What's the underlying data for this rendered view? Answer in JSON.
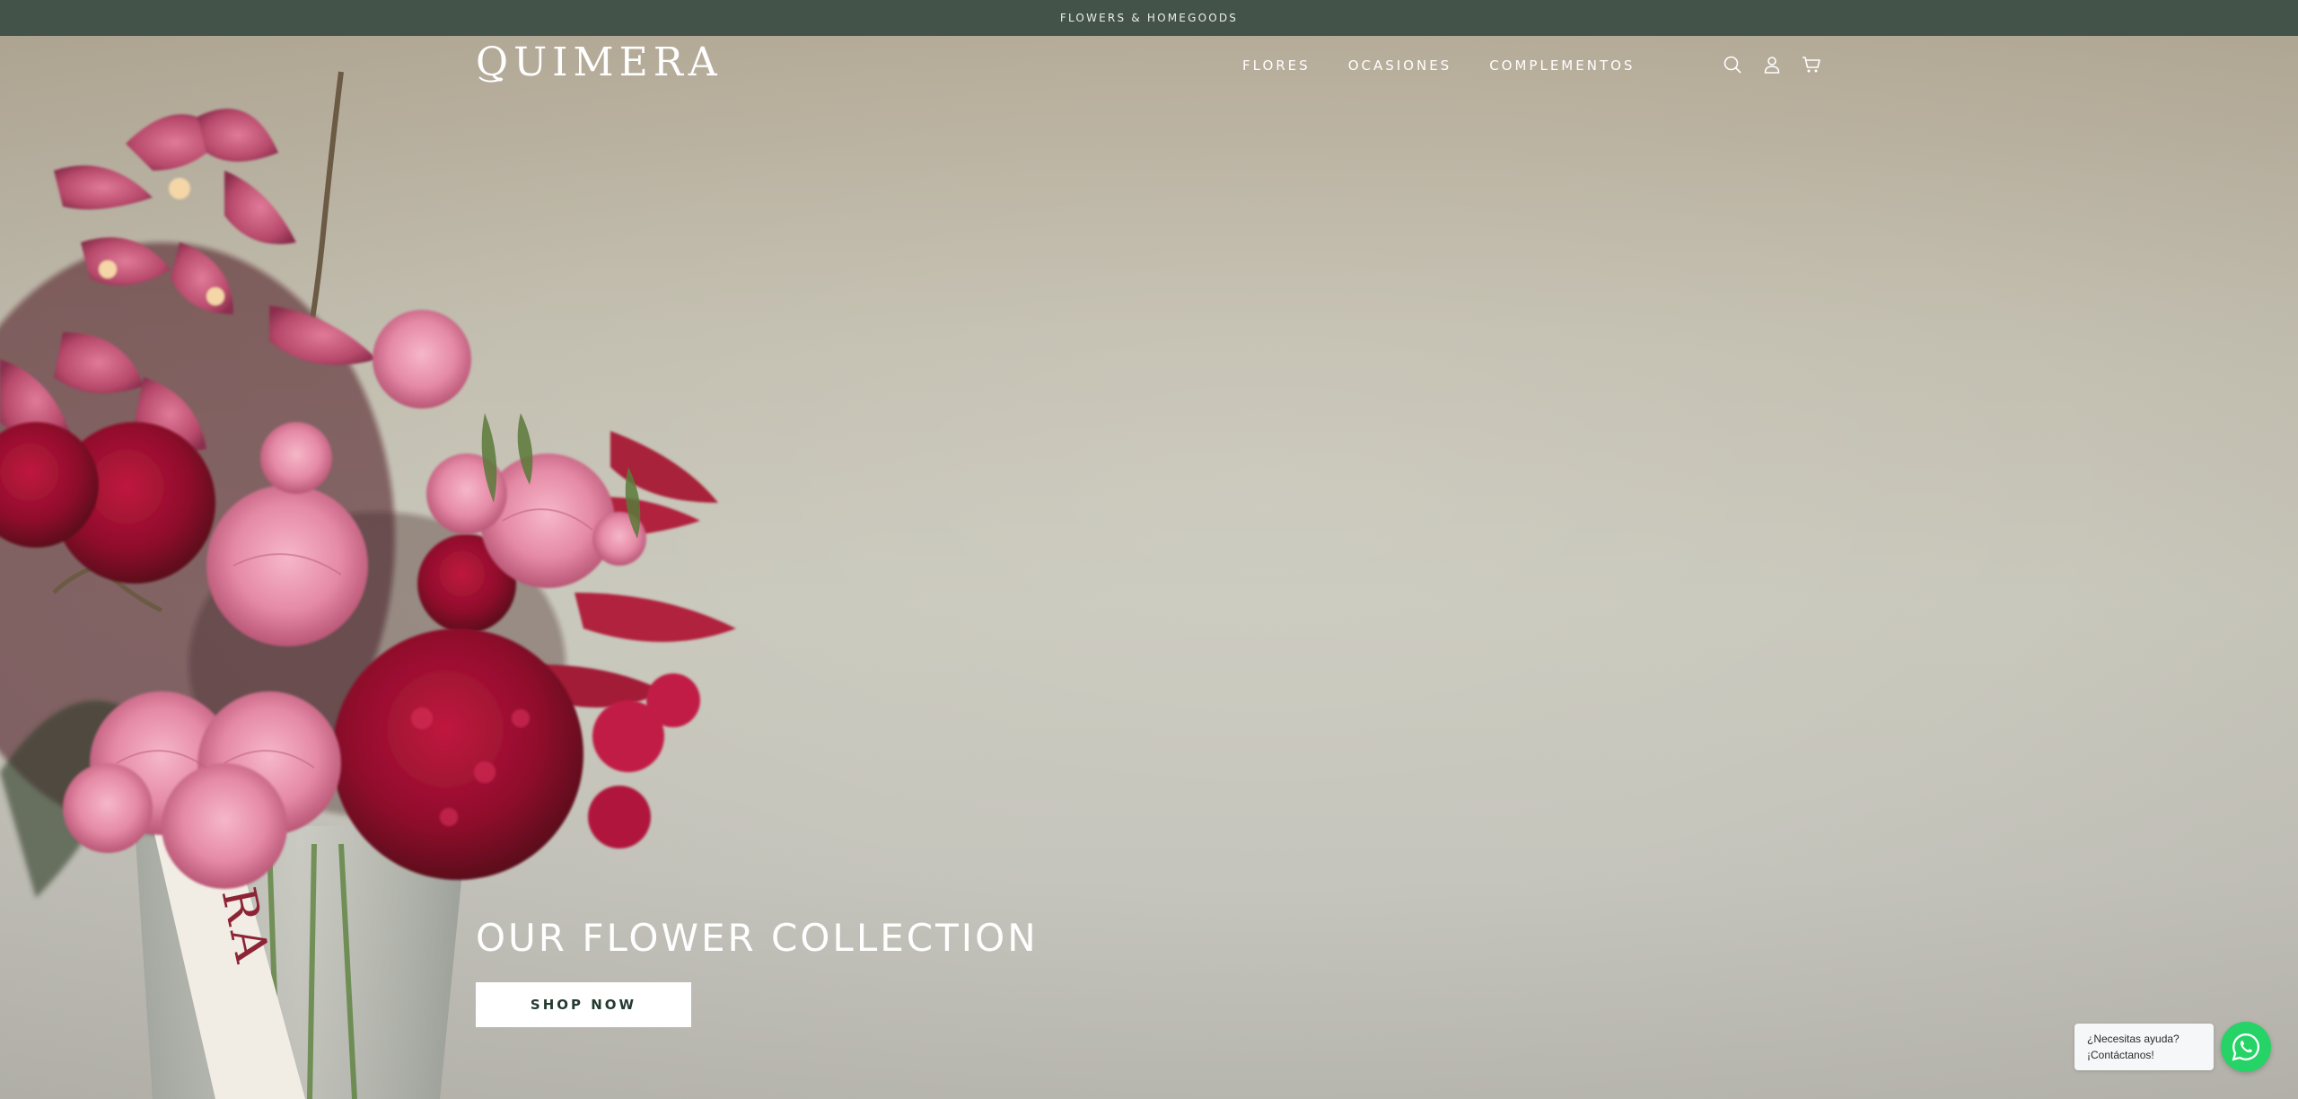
{
  "announcement": {
    "text": "FLOWERS & HOMEGOODS"
  },
  "header": {
    "logo": "QUIMERA",
    "nav": [
      {
        "label": "FLORES"
      },
      {
        "label": "OCASIONES"
      },
      {
        "label": "COMPLEMENTOS"
      }
    ],
    "icons": [
      "search-icon",
      "account-icon",
      "cart-icon"
    ]
  },
  "hero": {
    "title": "OUR FLOWER COLLECTION",
    "button_label": "SHOP NOW",
    "ribbon_text": "ERA"
  },
  "help_widget": {
    "line1": "¿Necesitas ayuda?",
    "line2": "¡Contáctanos!"
  },
  "colors": {
    "announcement_bg": "#44534a",
    "button_text": "#233a30",
    "whatsapp": "#25d366",
    "background": "#c9c8bc"
  }
}
